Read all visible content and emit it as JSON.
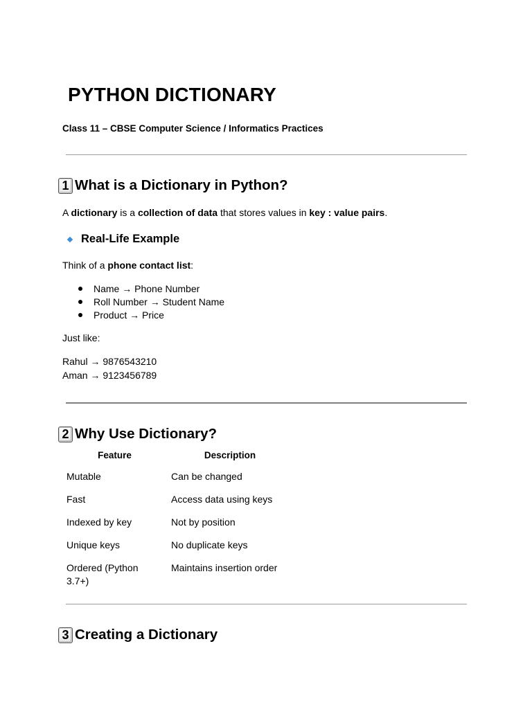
{
  "title": "PYTHON DICTIONARY",
  "subtitle": "Class 11 – CBSE Computer Science / Informatics Practices",
  "section1": {
    "number": "1",
    "heading": "What is a Dictionary in Python?",
    "intro": {
      "t1": "A ",
      "b1": "dictionary",
      "t2": " is a ",
      "b2": "collection of data",
      "t3": " that stores values in ",
      "b3": "key : value pairs",
      "t4": "."
    },
    "subheading": "Real-Life Example",
    "think": {
      "t1": "Think of a ",
      "b1": "phone contact list",
      "t2": ":"
    },
    "bullets": [
      "Name → Phone Number",
      "Roll Number → Student Name",
      "Product → Price"
    ],
    "just_like": "Just like:",
    "examples": [
      "Rahul → 9876543210",
      "Aman → 9123456789"
    ]
  },
  "section2": {
    "number": "2",
    "heading": "Why Use Dictionary?",
    "table": {
      "headers": [
        "Feature",
        "Description"
      ],
      "rows": [
        [
          "Mutable",
          "Can be changed"
        ],
        [
          "Fast",
          "Access data using keys"
        ],
        [
          "Indexed by key",
          "Not by position"
        ],
        [
          "Unique keys",
          "No duplicate keys"
        ],
        [
          "Ordered (Python 3.7+)",
          "Maintains insertion order"
        ]
      ]
    }
  },
  "section3": {
    "number": "3",
    "heading": "Creating a Dictionary"
  }
}
